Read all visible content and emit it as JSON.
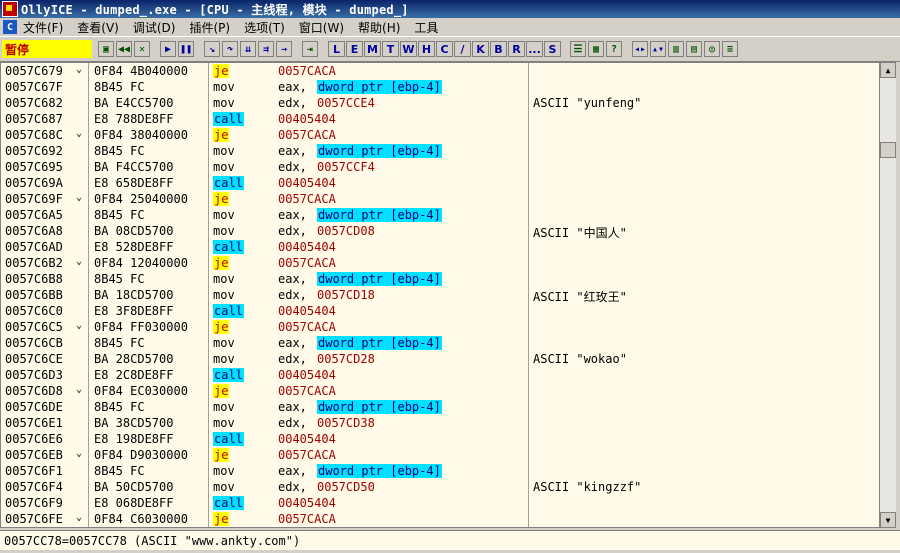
{
  "window": {
    "title": "OllyICE - dumped_.exe - [CPU - 主线程, 模块 - dumped_]"
  },
  "menu": [
    {
      "label": "文件(F)"
    },
    {
      "label": "查看(V)"
    },
    {
      "label": "调试(D)"
    },
    {
      "label": "插件(P)"
    },
    {
      "label": "选项(T)"
    },
    {
      "label": "窗口(W)"
    },
    {
      "label": "帮助(H)"
    },
    {
      "label": "工具"
    }
  ],
  "toolbar": {
    "status": "暂停",
    "letter_buttons": [
      "L",
      "E",
      "M",
      "T",
      "W",
      "H",
      "C",
      "/",
      "K",
      "B",
      "R",
      "...",
      "S"
    ]
  },
  "rows": [
    {
      "addr": "0057C679",
      "mark": "⌄",
      "hex": "0F84 4B040000",
      "mnem": "je",
      "style": "y",
      "op1": "0057CACA",
      "op1red": true,
      "op2": "",
      "cmt": ""
    },
    {
      "addr": "0057C67F",
      "mark": "",
      "hex": "8B45 FC",
      "mnem": "mov",
      "style": "",
      "op1": "eax,",
      "op1red": false,
      "op2": "dword ptr [ebp-4]",
      "cmt": ""
    },
    {
      "addr": "0057C682",
      "mark": "",
      "hex": "BA E4CC5700",
      "mnem": "mov",
      "style": "",
      "op1": "edx,",
      "op1red": false,
      "op2": "0057CCE4",
      "plain": true,
      "cmt": "ASCII \"yunfeng\""
    },
    {
      "addr": "0057C687",
      "mark": "",
      "hex": "E8 788DE8FF",
      "mnem": "call",
      "style": "c",
      "op1": "00405404",
      "op1red": true,
      "op2": "",
      "cmt": ""
    },
    {
      "addr": "0057C68C",
      "mark": "⌄",
      "hex": "0F84 38040000",
      "mnem": "je",
      "style": "y",
      "op1": "0057CACA",
      "op1red": true,
      "op2": "",
      "cmt": ""
    },
    {
      "addr": "0057C692",
      "mark": "",
      "hex": "8B45 FC",
      "mnem": "mov",
      "style": "",
      "op1": "eax,",
      "op1red": false,
      "op2": "dword ptr [ebp-4]",
      "cmt": ""
    },
    {
      "addr": "0057C695",
      "mark": "",
      "hex": "BA F4CC5700",
      "mnem": "mov",
      "style": "",
      "op1": "edx,",
      "op1red": false,
      "op2": "0057CCF4",
      "plain": true,
      "cmt": ""
    },
    {
      "addr": "0057C69A",
      "mark": "",
      "hex": "E8 658DE8FF",
      "mnem": "call",
      "style": "c",
      "op1": "00405404",
      "op1red": true,
      "op2": "",
      "cmt": ""
    },
    {
      "addr": "0057C69F",
      "mark": "⌄",
      "hex": "0F84 25040000",
      "mnem": "je",
      "style": "y",
      "op1": "0057CACA",
      "op1red": true,
      "op2": "",
      "cmt": ""
    },
    {
      "addr": "0057C6A5",
      "mark": "",
      "hex": "8B45 FC",
      "mnem": "mov",
      "style": "",
      "op1": "eax,",
      "op1red": false,
      "op2": "dword ptr [ebp-4]",
      "cmt": ""
    },
    {
      "addr": "0057C6A8",
      "mark": "",
      "hex": "BA 08CD5700",
      "mnem": "mov",
      "style": "",
      "op1": "edx,",
      "op1red": false,
      "op2": "0057CD08",
      "plain": true,
      "cmt": "ASCII \"中国人\""
    },
    {
      "addr": "0057C6AD",
      "mark": "",
      "hex": "E8 528DE8FF",
      "mnem": "call",
      "style": "c",
      "op1": "00405404",
      "op1red": true,
      "op2": "",
      "cmt": ""
    },
    {
      "addr": "0057C6B2",
      "mark": "⌄",
      "hex": "0F84 12040000",
      "mnem": "je",
      "style": "y",
      "op1": "0057CACA",
      "op1red": true,
      "op2": "",
      "cmt": ""
    },
    {
      "addr": "0057C6B8",
      "mark": "",
      "hex": "8B45 FC",
      "mnem": "mov",
      "style": "",
      "op1": "eax,",
      "op1red": false,
      "op2": "dword ptr [ebp-4]",
      "cmt": ""
    },
    {
      "addr": "0057C6BB",
      "mark": "",
      "hex": "BA 18CD5700",
      "mnem": "mov",
      "style": "",
      "op1": "edx,",
      "op1red": false,
      "op2": "0057CD18",
      "plain": true,
      "cmt": "ASCII \"红玫王\""
    },
    {
      "addr": "0057C6C0",
      "mark": "",
      "hex": "E8 3F8DE8FF",
      "mnem": "call",
      "style": "c",
      "op1": "00405404",
      "op1red": true,
      "op2": "",
      "cmt": ""
    },
    {
      "addr": "0057C6C5",
      "mark": "⌄",
      "hex": "0F84 FF030000",
      "mnem": "je",
      "style": "y",
      "op1": "0057CACA",
      "op1red": true,
      "op2": "",
      "cmt": ""
    },
    {
      "addr": "0057C6CB",
      "mark": "",
      "hex": "8B45 FC",
      "mnem": "mov",
      "style": "",
      "op1": "eax,",
      "op1red": false,
      "op2": "dword ptr [ebp-4]",
      "cmt": ""
    },
    {
      "addr": "0057C6CE",
      "mark": "",
      "hex": "BA 28CD5700",
      "mnem": "mov",
      "style": "",
      "op1": "edx,",
      "op1red": false,
      "op2": "0057CD28",
      "plain": true,
      "cmt": "ASCII \"wokao\""
    },
    {
      "addr": "0057C6D3",
      "mark": "",
      "hex": "E8 2C8DE8FF",
      "mnem": "call",
      "style": "c",
      "op1": "00405404",
      "op1red": true,
      "op2": "",
      "cmt": ""
    },
    {
      "addr": "0057C6D8",
      "mark": "⌄",
      "hex": "0F84 EC030000",
      "mnem": "je",
      "style": "y",
      "op1": "0057CACA",
      "op1red": true,
      "op2": "",
      "cmt": ""
    },
    {
      "addr": "0057C6DE",
      "mark": "",
      "hex": "8B45 FC",
      "mnem": "mov",
      "style": "",
      "op1": "eax,",
      "op1red": false,
      "op2": "dword ptr [ebp-4]",
      "cmt": ""
    },
    {
      "addr": "0057C6E1",
      "mark": "",
      "hex": "BA 38CD5700",
      "mnem": "mov",
      "style": "",
      "op1": "edx,",
      "op1red": false,
      "op2": "0057CD38",
      "plain": true,
      "cmt": ""
    },
    {
      "addr": "0057C6E6",
      "mark": "",
      "hex": "E8 198DE8FF",
      "mnem": "call",
      "style": "c",
      "op1": "00405404",
      "op1red": true,
      "op2": "",
      "cmt": ""
    },
    {
      "addr": "0057C6EB",
      "mark": "⌄",
      "hex": "0F84 D9030000",
      "mnem": "je",
      "style": "y",
      "op1": "0057CACA",
      "op1red": true,
      "op2": "",
      "cmt": ""
    },
    {
      "addr": "0057C6F1",
      "mark": "",
      "hex": "8B45 FC",
      "mnem": "mov",
      "style": "",
      "op1": "eax,",
      "op1red": false,
      "op2": "dword ptr [ebp-4]",
      "cmt": ""
    },
    {
      "addr": "0057C6F4",
      "mark": "",
      "hex": "BA 50CD5700",
      "mnem": "mov",
      "style": "",
      "op1": "edx,",
      "op1red": false,
      "op2": "0057CD50",
      "plain": true,
      "cmt": "ASCII \"kingzzf\""
    },
    {
      "addr": "0057C6F9",
      "mark": "",
      "hex": "E8 068DE8FF",
      "mnem": "call",
      "style": "c",
      "op1": "00405404",
      "op1red": true,
      "op2": "",
      "cmt": ""
    },
    {
      "addr": "0057C6FE",
      "mark": "⌄",
      "hex": "0F84 C6030000",
      "mnem": "je",
      "style": "y",
      "op1": "0057CACA",
      "op1red": true,
      "op2": "",
      "cmt": ""
    }
  ],
  "info": {
    "text": "0057CC78=0057CC78 (ASCII \"www.ankty.com\")"
  },
  "colors": {
    "pane_bg": "#fffbe8",
    "jump_highlight": "#ffff00",
    "call_highlight": "#00e0ff"
  }
}
